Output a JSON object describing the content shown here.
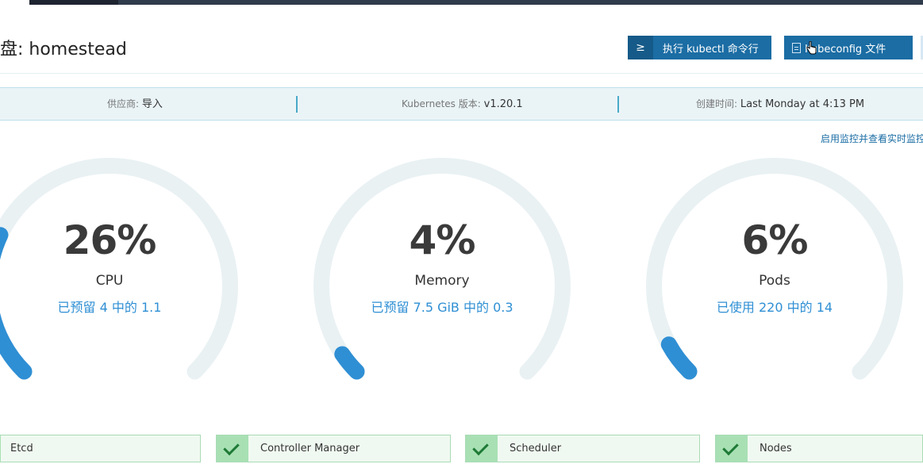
{
  "header": {
    "title": "盘: homestead",
    "kubectl_button": {
      "icon": "≥",
      "label": "执行 kubectl 命令行"
    },
    "kubeconfig_button": {
      "label": "Kubeconfig 文件"
    }
  },
  "info": {
    "provider_label": "供应商:",
    "provider_value": "导入",
    "k8s_label": "Kubernetes 版本:",
    "k8s_value": "v1.20.1",
    "created_label": "创建时间:",
    "created_value": "Last Monday at 4:13 PM"
  },
  "monitoring_link": "启用监控并查看实时监控",
  "gauges": [
    {
      "percent_text": "26%",
      "percent": 0.26,
      "name": "CPU",
      "detail": "已预留 4 中的 1.1"
    },
    {
      "percent_text": "4%",
      "percent": 0.04,
      "name": "Memory",
      "detail": "已预留 7.5 GiB 中的 0.3"
    },
    {
      "percent_text": "6%",
      "percent": 0.06,
      "name": "Pods",
      "detail": "已使用 220 中的 14"
    }
  ],
  "components": [
    {
      "name": "Etcd",
      "healthy": true
    },
    {
      "name": "Controller Manager",
      "healthy": true
    },
    {
      "name": "Scheduler",
      "healthy": true
    },
    {
      "name": "Nodes",
      "healthy": true
    }
  ],
  "colors": {
    "accent": "#1b6da4",
    "gauge_fill": "#2f8fd4",
    "gauge_track": "#e9f1f3",
    "healthy": "#1e7a36"
  }
}
